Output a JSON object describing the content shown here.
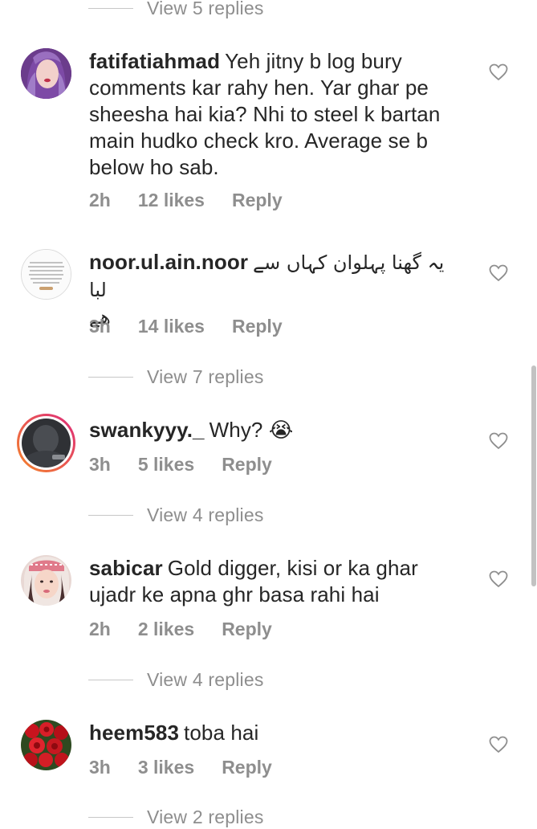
{
  "comments": [
    {
      "username": "fatifatiahmad",
      "text": "Yeh jitny b log bury comments kar rahy hen. Yar ghar pe sheesha hai kia? Nhi to steel k bartan main hudko check kro. Average se b below ho sab.",
      "time": "2h",
      "likes": "12 likes",
      "reply": "Reply",
      "avatar_icon": "avatar-purple-hair",
      "liked": false
    },
    {
      "username": "noor.ul.ain.noor",
      "text": "یہ گھنا پہلوان کہاں سے لبا",
      "text_line2": "ھے",
      "time": "3h",
      "likes": "14 likes",
      "reply": "Reply",
      "avatar_icon": "avatar-quote-image",
      "avatar_quote": "When you don't understand what's happening in your life, just close your eyes, and take a deep breath and say, \"Ya Allah, I know this is your plan, just help me through it.\"",
      "view_replies": "View 7 replies"
    },
    {
      "username": "swankyyy._",
      "text": "Why?",
      "emoji": "😭",
      "time": "3h",
      "likes": "5 likes",
      "reply": "Reply",
      "avatar_icon": "avatar-story-ring",
      "view_replies": "View 4 replies"
    },
    {
      "username": "sabicar",
      "text": "Gold digger, kisi or ka ghar ujadr ke apna ghr basa rahi hai",
      "time": "2h",
      "likes": "2 likes",
      "reply": "Reply",
      "avatar_icon": "avatar-girl-scarf",
      "view_replies": "View 4 replies"
    },
    {
      "username": "heem583",
      "text": "toba hai",
      "time": "3h",
      "likes": "3 likes",
      "reply": "Reply",
      "avatar_icon": "avatar-red-roses"
    }
  ],
  "top_view_replies": "View 5 replies",
  "bottom_view_replies": "View 2 replies",
  "colors": {
    "text": "#262626",
    "muted": "#8e8e8e",
    "divider": "#c7c7c7",
    "story_ring_start": "#f58529",
    "story_ring_end": "#dd2a7b"
  }
}
